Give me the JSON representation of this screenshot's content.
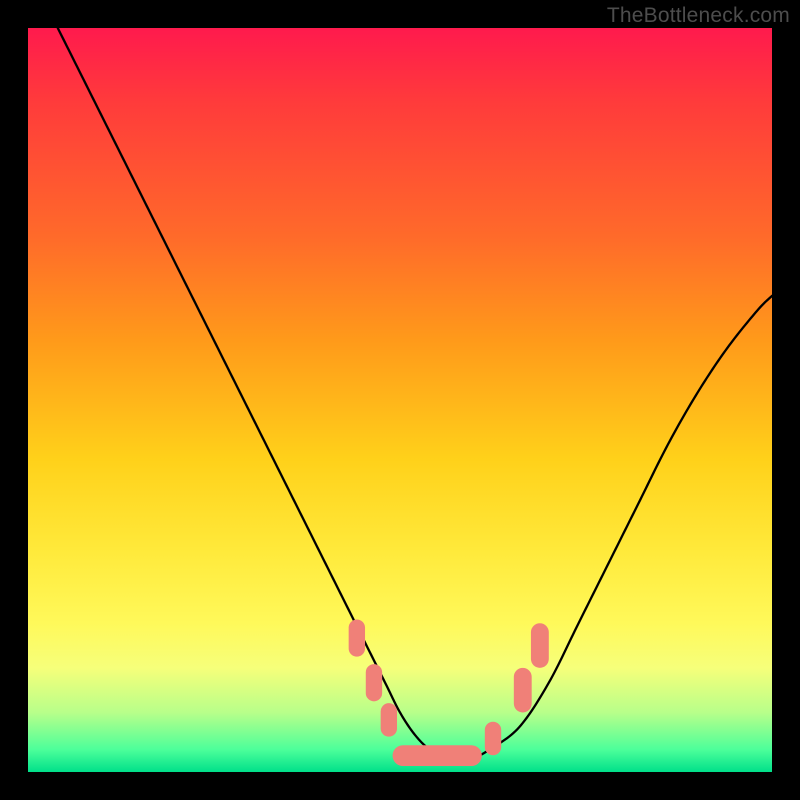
{
  "watermark": "TheBottleneck.com",
  "chart_data": {
    "type": "line",
    "title": "",
    "xlabel": "",
    "ylabel": "",
    "xlim": [
      0,
      100
    ],
    "ylim": [
      0,
      100
    ],
    "grid": false,
    "legend": false,
    "annotations": [],
    "background_gradient_stops": [
      {
        "pos": 0,
        "color": "#ff1a4d"
      },
      {
        "pos": 10,
        "color": "#ff3b3b"
      },
      {
        "pos": 28,
        "color": "#ff6a2a"
      },
      {
        "pos": 42,
        "color": "#ff9a1a"
      },
      {
        "pos": 58,
        "color": "#ffd11a"
      },
      {
        "pos": 70,
        "color": "#ffe93a"
      },
      {
        "pos": 80,
        "color": "#fff95a"
      },
      {
        "pos": 86,
        "color": "#f6ff7a"
      },
      {
        "pos": 92,
        "color": "#b8ff8a"
      },
      {
        "pos": 97,
        "color": "#4cff9a"
      },
      {
        "pos": 100,
        "color": "#00e08a"
      }
    ],
    "series": [
      {
        "name": "bottleneck-curve",
        "color": "#000000",
        "x": [
          4,
          8,
          12,
          16,
          20,
          24,
          28,
          32,
          36,
          40,
          44,
          48,
          50,
          52,
          54,
          56,
          58,
          60,
          62,
          66,
          70,
          74,
          78,
          82,
          86,
          90,
          94,
          98,
          100
        ],
        "y": [
          100,
          92,
          84,
          76,
          68,
          60,
          52,
          44,
          36,
          28,
          20,
          12,
          8,
          5,
          3,
          2,
          2,
          2,
          3,
          6,
          12,
          20,
          28,
          36,
          44,
          51,
          57,
          62,
          64
        ]
      }
    ],
    "markers": {
      "name": "highlight-lozenges",
      "color": "#f08078",
      "shape": "rounded-rect",
      "points": [
        {
          "x": 44.2,
          "y": 18,
          "w": 2.2,
          "h": 5
        },
        {
          "x": 46.5,
          "y": 12,
          "w": 2.2,
          "h": 5
        },
        {
          "x": 48.5,
          "y": 7,
          "w": 2.2,
          "h": 4.5
        },
        {
          "x": 55.0,
          "y": 2.2,
          "w": 12,
          "h": 2.8
        },
        {
          "x": 62.5,
          "y": 4.5,
          "w": 2.2,
          "h": 4.5
        },
        {
          "x": 66.5,
          "y": 11,
          "w": 2.4,
          "h": 6
        },
        {
          "x": 68.8,
          "y": 17,
          "w": 2.4,
          "h": 6
        }
      ]
    }
  }
}
